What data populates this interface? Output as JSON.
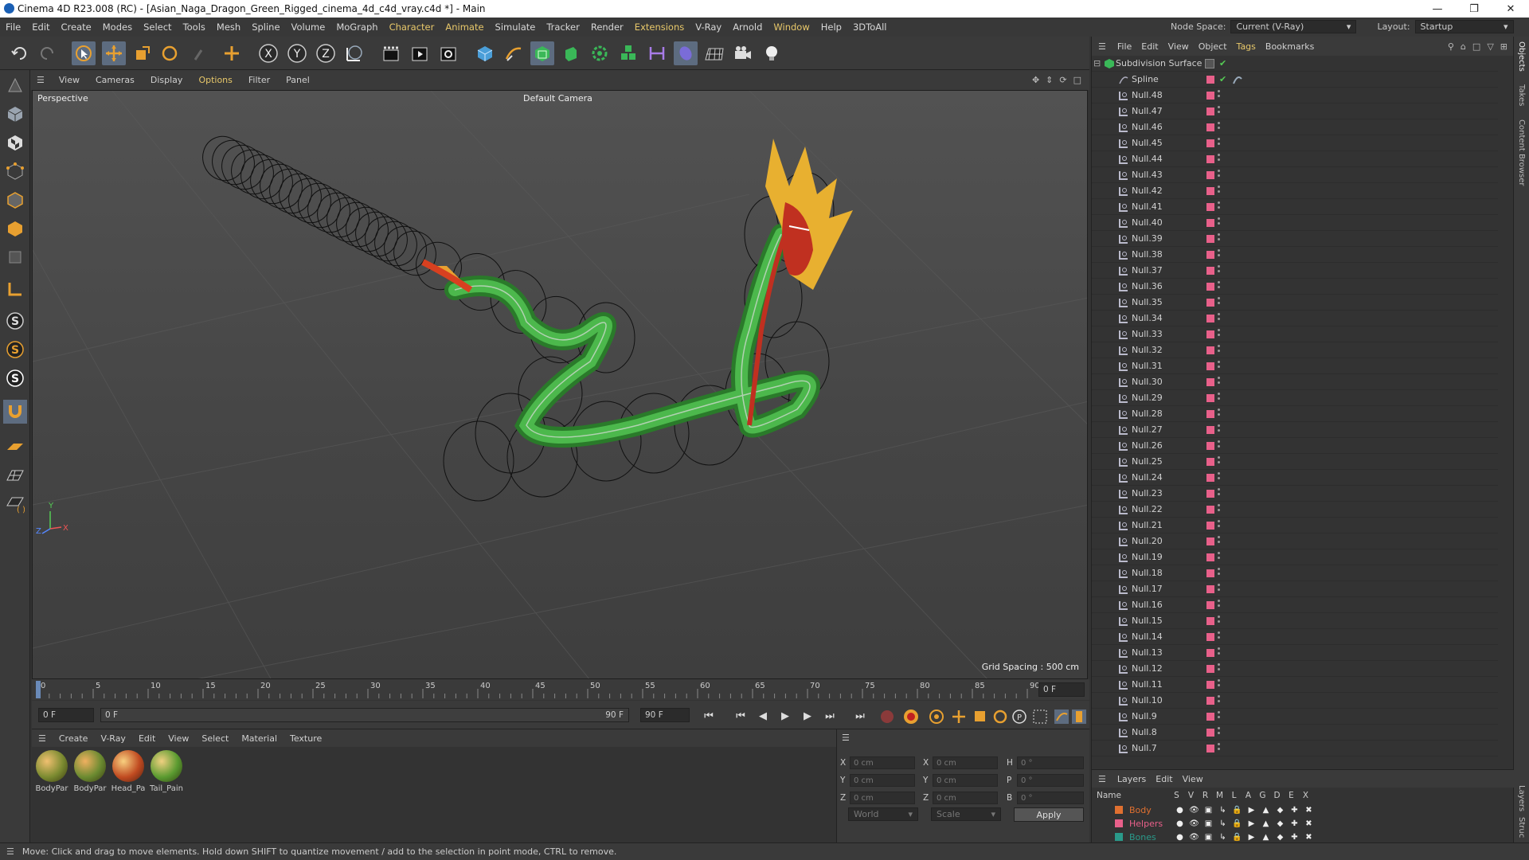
{
  "window": {
    "title": "Cinema 4D R23.008 (RC) - [Asian_Naga_Dragon_Green_Rigged_cinema_4d_c4d_vray.c4d *] - Main"
  },
  "menubar": {
    "items": [
      "File",
      "Edit",
      "Create",
      "Modes",
      "Select",
      "Tools",
      "Mesh",
      "Spline",
      "Volume",
      "MoGraph",
      "Character",
      "Animate",
      "Simulate",
      "Tracker",
      "Render",
      "Extensions",
      "V-Ray",
      "Arnold",
      "Window",
      "Help",
      "3DToAll"
    ],
    "node_space_label": "Node Space:",
    "node_space_value": "Current (V-Ray)",
    "layout_label": "Layout:",
    "layout_value": "Startup"
  },
  "viewport": {
    "menu": [
      "View",
      "Cameras",
      "Display",
      "Options",
      "Filter",
      "Panel"
    ],
    "label": "Perspective",
    "camera": "Default Camera",
    "grid_spacing": "Grid Spacing : 500 cm"
  },
  "timeline": {
    "ticks": [
      "0",
      "5",
      "10",
      "15",
      "20",
      "25",
      "30",
      "35",
      "40",
      "45",
      "50",
      "55",
      "60",
      "65",
      "70",
      "75",
      "80",
      "85",
      "90"
    ],
    "current_frame": "0 F",
    "start_frame": "0 F",
    "range_start": "0 F",
    "range_end": "90 F",
    "end_frame": "90 F"
  },
  "material": {
    "menu": [
      "Create",
      "V-Ray",
      "Edit",
      "View",
      "Select",
      "Material",
      "Texture"
    ],
    "items": [
      "BodyPar",
      "BodyPar",
      "Head_Pa",
      "Tail_Pain"
    ]
  },
  "coords": {
    "pos_x": "0 cm",
    "pos_y": "0 cm",
    "pos_z": "0 cm",
    "size_x": "0 cm",
    "size_y": "0 cm",
    "size_z": "0 cm",
    "rot_h": "0 °",
    "rot_p": "0 °",
    "rot_b": "0 °",
    "labels": [
      "X",
      "Y",
      "Z",
      "X",
      "Y",
      "Z",
      "H",
      "P",
      "B"
    ],
    "world": "World",
    "scale": "Scale",
    "apply": "Apply"
  },
  "objects": {
    "menu": [
      "File",
      "Edit",
      "View",
      "Object",
      "Tags",
      "Bookmarks"
    ],
    "root": "Subdivision Surface",
    "spline": "Spline",
    "nulls": [
      "Null.48",
      "Null.47",
      "Null.46",
      "Null.45",
      "Null.44",
      "Null.43",
      "Null.42",
      "Null.41",
      "Null.40",
      "Null.39",
      "Null.38",
      "Null.37",
      "Null.36",
      "Null.35",
      "Null.34",
      "Null.33",
      "Null.32",
      "Null.31",
      "Null.30",
      "Null.29",
      "Null.28",
      "Null.27",
      "Null.26",
      "Null.25",
      "Null.24",
      "Null.23",
      "Null.22",
      "Null.21",
      "Null.20",
      "Null.19",
      "Null.18",
      "Null.17",
      "Null.16",
      "Null.15",
      "Null.14",
      "Null.13",
      "Null.12",
      "Null.11",
      "Null.10",
      "Null.9",
      "Null.8",
      "Null.7"
    ]
  },
  "layers": {
    "menu": [
      "Layers",
      "Edit",
      "View"
    ],
    "header_name": "Name",
    "columns": [
      "S",
      "V",
      "R",
      "M",
      "L",
      "A",
      "G",
      "D",
      "E",
      "X"
    ],
    "rows": [
      {
        "name": "Body",
        "color": "#e07030"
      },
      {
        "name": "Helpers",
        "color": "#e8608a"
      },
      {
        "name": "Bones",
        "color": "#2a9a8a"
      }
    ]
  },
  "right_tabs": [
    "Objects",
    "Takes",
    "Content Browser",
    "Layers",
    "Struc"
  ],
  "status": {
    "text": "Move: Click and drag to move elements. Hold down SHIFT to quantize movement / add to the selection in point mode, CTRL to remove."
  }
}
